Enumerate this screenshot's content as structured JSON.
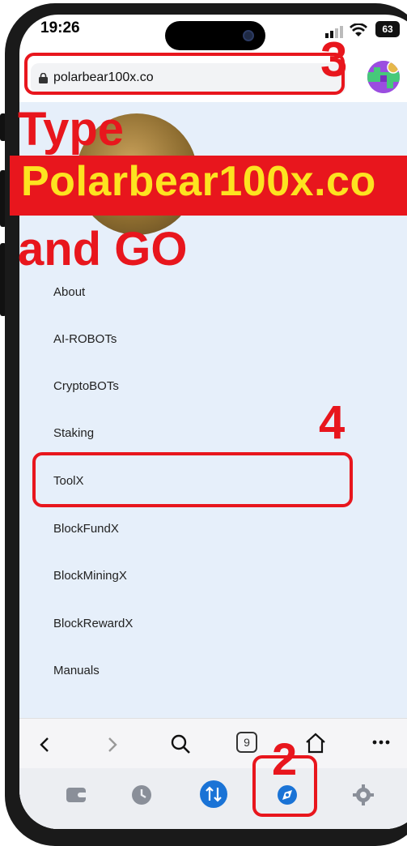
{
  "status": {
    "time": "19:26",
    "battery": "63"
  },
  "browser": {
    "url": "polarbear100x.co"
  },
  "menu": {
    "items": [
      "About",
      "AI-ROBOTs",
      "CryptoBOTs",
      "Staking",
      "ToolX",
      "BlockFundX",
      "BlockMiningX",
      "BlockRewardX",
      "Manuals"
    ]
  },
  "bottom_nav": {
    "tab_count": "9"
  },
  "annotations": {
    "type_line": "Type",
    "site_line": "Polarbear100x.co",
    "go_line": "and GO",
    "step_2": "2",
    "step_3": "3",
    "step_4": "4"
  },
  "colors": {
    "annotation_red": "#e8161d",
    "annotation_yellow": "#fde320",
    "page_bg": "#e6effa",
    "accent_blue": "#1a73d6"
  }
}
